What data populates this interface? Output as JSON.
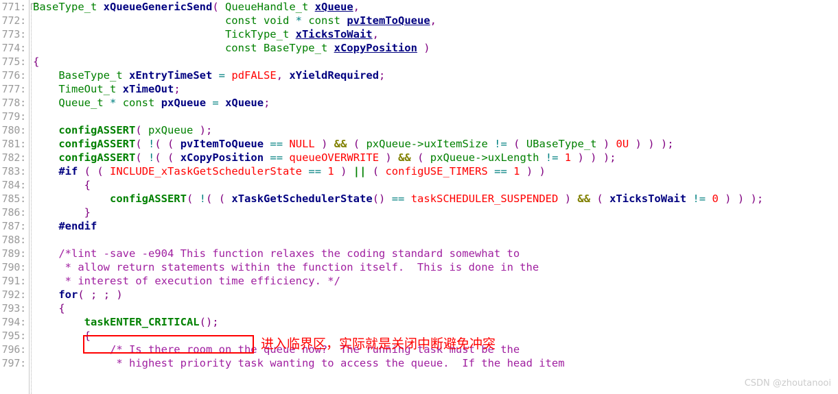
{
  "editor": {
    "language": "c",
    "first_line_number": 771,
    "last_line_number": 797,
    "line_height_px": 20,
    "gutter_separator_color": "#c8c8c8"
  },
  "colors": {
    "background": "#ffffff",
    "line_number": "#9a9a9a",
    "type": "#008000",
    "keyword": "#000080",
    "function_name": "#000080",
    "variable": "#000080",
    "macro_constant": "#ff0000",
    "number": "#ff0000",
    "function_call": "#008000",
    "parenthesis": "#800080",
    "operator": "#008080",
    "logical_and": "#808000",
    "logical_or": "#008000",
    "comment": "#a020a0",
    "annotation": "#ff0000",
    "highlight_border": "#ff0000",
    "watermark": "#cccccc"
  },
  "line_numbers": [
    "771:",
    "772:",
    "773:",
    "774:",
    "775:",
    "776:",
    "777:",
    "778:",
    "779:",
    "780:",
    "781:",
    "782:",
    "783:",
    "784:",
    "785:",
    "786:",
    "787:",
    "788:",
    "789:",
    "790:",
    "791:",
    "792:",
    "793:",
    "794:",
    "795:",
    "796:",
    "797:"
  ],
  "code_lines": [
    "BaseType_t xQueueGenericSend( QueueHandle_t xQueue,",
    "                              const void * const pvItemToQueue,",
    "                              TickType_t xTicksToWait,",
    "                              const BaseType_t xCopyPosition )",
    "{",
    "    BaseType_t xEntryTimeSet = pdFALSE, xYieldRequired;",
    "    TimeOut_t xTimeOut;",
    "    Queue_t * const pxQueue = xQueue;",
    "",
    "    configASSERT( pxQueue );",
    "    configASSERT( !( ( pvItemToQueue == NULL ) && ( pxQueue->uxItemSize != ( UBaseType_t ) 0U ) ) );",
    "    configASSERT( !( ( xCopyPosition == queueOVERWRITE ) && ( pxQueue->uxLength != 1 ) ) );",
    "    #if ( ( INCLUDE_xTaskGetSchedulerState == 1 ) || ( configUSE_TIMERS == 1 ) )",
    "        {",
    "            configASSERT( !( ( xTaskGetSchedulerState() == taskSCHEDULER_SUSPENDED ) && ( xTicksToWait != 0 ) ) );",
    "        }",
    "    #endif",
    "",
    "    /*lint -save -e904 This function relaxes the coding standard somewhat to",
    "     * allow return statements within the function itself.  This is done in the",
    "     * interest of execution time efficiency. */",
    "    for( ; ; )",
    "    {",
    "        taskENTER_CRITICAL();",
    "        {",
    "            /* Is there room on the queue now?  The running task must be the",
    "             * highest priority task wanting to access the queue.  If the head item"
  ],
  "annotation": {
    "text": "进入临界区，实际就是关闭中断避免冲突",
    "target_line_number": 794,
    "target_code": "taskENTER_CRITICAL();"
  },
  "watermark": {
    "text": "CSDN @zhoutanooi"
  }
}
